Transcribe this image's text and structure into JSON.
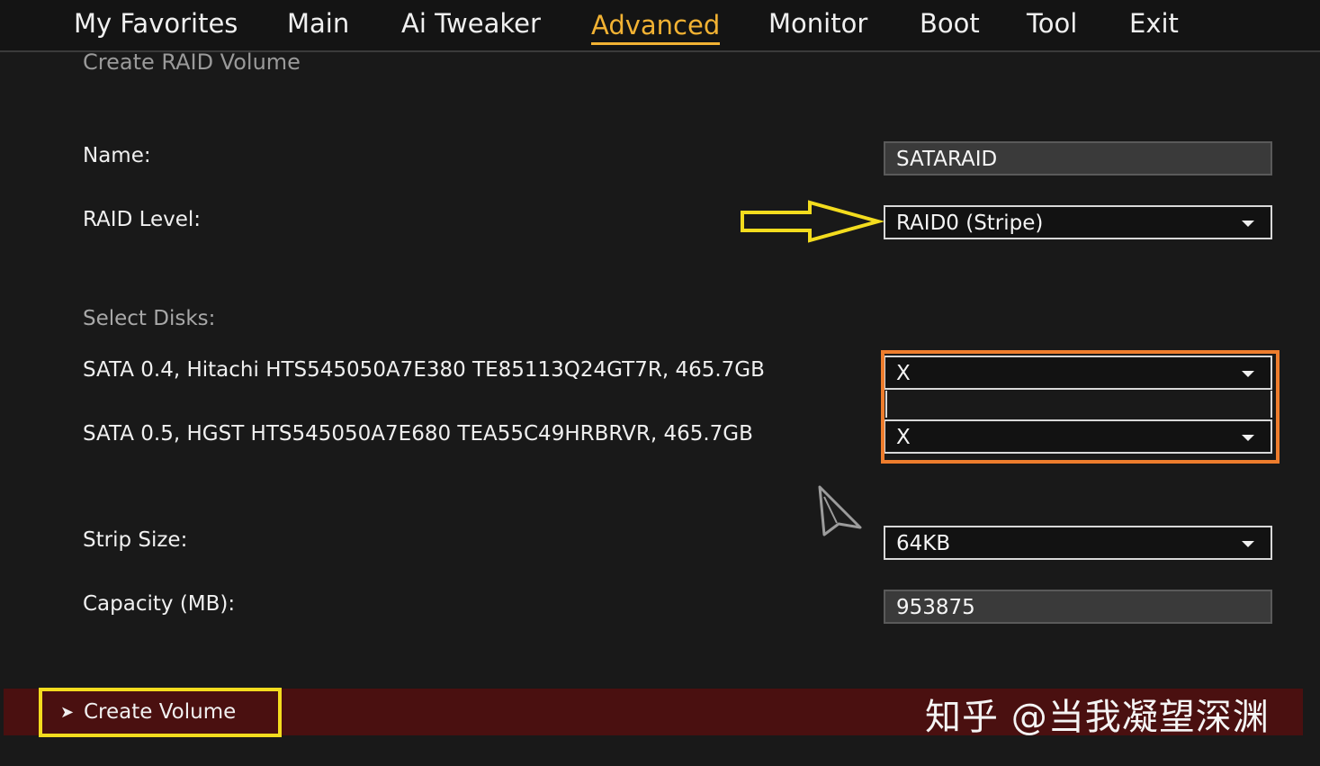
{
  "menu": {
    "items": [
      {
        "label": "My Favorites"
      },
      {
        "label": "Main"
      },
      {
        "label": "Ai Tweaker"
      },
      {
        "label": "Advanced",
        "active": true
      },
      {
        "label": "Monitor"
      },
      {
        "label": "Boot"
      },
      {
        "label": "Tool"
      },
      {
        "label": "Exit"
      }
    ]
  },
  "section_title": "Create RAID Volume",
  "form": {
    "name": {
      "label": "Name:",
      "value": "SATARAID"
    },
    "raid_level": {
      "label": "RAID Level:",
      "value": "RAID0 (Stripe)"
    },
    "select_disks_label": "Select Disks:",
    "disks": [
      {
        "label": "SATA 0.4, Hitachi HTS545050A7E380 TE85113Q24GT7R, 465.7GB",
        "value": "X"
      },
      {
        "label": "SATA 0.5, HGST HTS545050A7E680 TEA55C49HRBRVR, 465.7GB",
        "value": "X"
      }
    ],
    "strip_size": {
      "label": "Strip Size:",
      "value": "64KB"
    },
    "capacity": {
      "label": "Capacity (MB):",
      "value": "953875"
    }
  },
  "actions": {
    "create_volume_label": "Create Volume"
  },
  "watermark": "知乎 @当我凝望深渊",
  "colors": {
    "accent": "#f2b233",
    "highlight_orange": "#ee7d2d",
    "highlight_yellow": "#f3dc1e",
    "bottom_bar": "#4a1010"
  },
  "icons": {
    "dropdown": "chevron-down-icon",
    "create_volume": "arrow-right-icon",
    "pointer": "mouse-cursor-icon",
    "annotation": "annotation-arrow-icon"
  }
}
